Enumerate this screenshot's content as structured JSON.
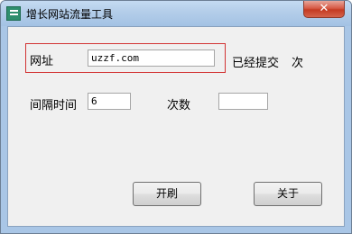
{
  "window": {
    "title": "增长网站流量工具",
    "close_label": "✕"
  },
  "form": {
    "url_label": "网址",
    "url_value": "uzzf.com",
    "submitted_label": "已经提交",
    "submitted_count": "",
    "times_suffix": "次",
    "interval_label": "间隔时间",
    "interval_value": "6",
    "count_label": "次数",
    "count_value": ""
  },
  "buttons": {
    "refresh_label": "开刷",
    "about_label": "关于"
  }
}
